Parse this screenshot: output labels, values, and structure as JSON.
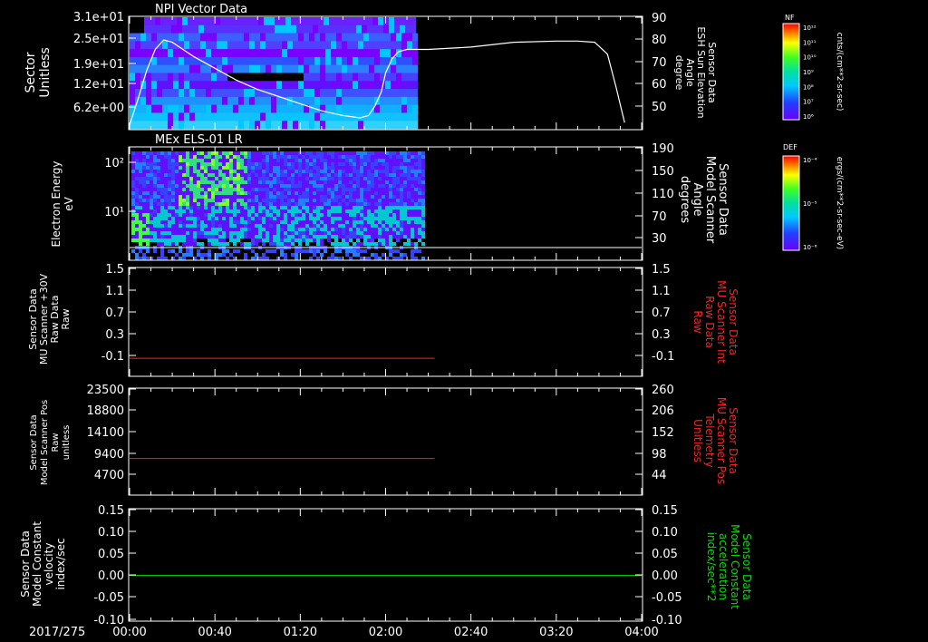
{
  "time_axis": {
    "date_label": "2017/275",
    "ticks": [
      "00:00",
      "00:40",
      "01:20",
      "02:00",
      "02:40",
      "03:20",
      "04:00"
    ],
    "tick_minutes": [
      0,
      40,
      80,
      120,
      160,
      200,
      240
    ],
    "range_minutes": [
      0,
      240
    ]
  },
  "colors": {
    "background": "#000000",
    "axis": "#ffffff",
    "red": "#ff2020",
    "green": "#00e000"
  },
  "panels": [
    {
      "id": "npi",
      "title": "NPI Vector Data",
      "left_label": [
        "Sector",
        "Unitless"
      ],
      "left_ticks": [
        "3.1e+01",
        "2.5e+01",
        "1.9e+01",
        "1.2e+01",
        "6.2e+00"
      ],
      "right_label": [
        "Sensor Data",
        "ESH Sun Elevation",
        "Angle",
        "degree"
      ],
      "right_ticks": [
        "90",
        "80",
        "70",
        "60",
        "50"
      ],
      "colorbar": {
        "title": "NF",
        "unit": "cnts/(cm**2-sr-sec)",
        "ticks": [
          "10¹²",
          "10¹¹",
          "10¹⁰",
          "10⁹",
          "10⁸",
          "10⁷",
          "10⁶"
        ]
      }
    },
    {
      "id": "els",
      "title": "MEx ELS-01 LR",
      "left_label": [
        "Electron Energy",
        "eV"
      ],
      "left_ticks": [
        "10²",
        "10¹"
      ],
      "right_label": [
        "Sensor Data",
        "Model Scanner",
        "Angle",
        "degrees"
      ],
      "right_ticks": [
        "190",
        "150",
        "110",
        "70",
        "30"
      ],
      "colorbar": {
        "title": "DEF",
        "unit": "ergs/(cm**2-sr-sec-eV)",
        "ticks": [
          "10⁻⁴",
          "10⁻⁵",
          "10⁻⁶"
        ]
      }
    },
    {
      "id": "raw30v",
      "left_label": [
        "Sensor Data",
        "MU Scanner +30V",
        "Raw Data",
        "Raw"
      ],
      "left_ticks": [
        "1.5",
        "1.1",
        "0.7",
        "0.3",
        "-0.1"
      ],
      "right_label": [
        "Sensor Data",
        "MU Scanner Int",
        "Raw Data",
        "Raw"
      ],
      "right_ticks": [
        "1.5",
        "1.1",
        "0.7",
        "0.3",
        "-0.1"
      ]
    },
    {
      "id": "pos",
      "left_label": [
        "Sensor Data",
        "Model Scanner Pos",
        "Raw",
        "unitless"
      ],
      "left_ticks": [
        "23500",
        "18800",
        "14100",
        "9400",
        "4700"
      ],
      "right_label": [
        "Sensor Data",
        "MU Scanner Pos",
        "Telemetry",
        "Unitless"
      ],
      "right_ticks": [
        "260",
        "206",
        "152",
        "98",
        "44"
      ]
    },
    {
      "id": "vel",
      "left_label": [
        "Sensor Data",
        "Model Constant",
        "velocity",
        "index/sec"
      ],
      "left_ticks": [
        "0.15",
        "0.10",
        "0.05",
        "0.00",
        "-0.05",
        "-0.10"
      ],
      "right_label": [
        "Sensor Data",
        "Model Constant",
        "acceleration",
        "index/sec**2"
      ],
      "right_ticks": [
        "0.15",
        "0.10",
        "0.05",
        "0.00",
        "-0.05",
        "-0.10"
      ]
    }
  ],
  "chart_data": [
    {
      "type": "heatmap",
      "title": "NPI Vector Data",
      "ylabel": "Sector Unitless",
      "y2label": "Sensor Data ESH Sun Elevation Angle degree",
      "data_coverage_minutes": [
        0,
        133
      ],
      "overlay_series": {
        "name": "ESH Sun Elevation",
        "x_minutes": [
          0,
          4,
          8,
          12,
          16,
          20,
          25,
          30,
          40,
          50,
          60,
          70,
          80,
          90,
          100,
          108,
          112,
          115,
          118,
          120,
          123,
          126,
          130,
          140,
          160,
          180,
          200,
          210,
          218,
          224,
          228,
          232
        ],
        "y_deg": [
          44,
          55,
          67,
          76,
          80,
          79,
          76,
          73,
          68,
          63,
          59,
          56,
          53,
          50,
          48,
          47,
          48,
          52,
          58,
          66,
          72,
          75,
          76,
          76,
          77,
          79,
          79.5,
          79.5,
          79,
          74,
          60,
          45
        ]
      },
      "ylim": [
        2,
        32
      ],
      "y2lim": [
        42,
        90
      ]
    },
    {
      "type": "heatmap",
      "title": "MEx ELS-01 LR",
      "ylabel": "Electron Energy eV",
      "y2label": "Sensor Data Model Scanner Angle degrees",
      "data_coverage_minutes": [
        0,
        137
      ],
      "overlay_series": {
        "name": "Model Scanner Angle",
        "x_minutes": [
          0,
          240
        ],
        "y_deg": [
          10,
          10
        ]
      },
      "y2lim": [
        0,
        190
      ]
    },
    {
      "type": "line",
      "ylabel": "Sensor Data MU Scanner +30V Raw Data Raw",
      "y2label": "Sensor Data MU Scanner Int Raw Data Raw",
      "series": [
        {
          "x_minutes": [
            0,
            143
          ],
          "values": [
            0.0,
            0.0
          ]
        }
      ],
      "ylim": [
        -0.3,
        1.5
      ]
    },
    {
      "type": "line",
      "ylabel": "Sensor Data Model Scanner Pos Raw unitless",
      "y2label": "Sensor Data MU Scanner Pos Telemetry Unitless",
      "series": [
        {
          "x_minutes": [
            0,
            143
          ],
          "values": [
            8100,
            8100
          ]
        }
      ],
      "ylim": [
        0,
        23500
      ]
    },
    {
      "type": "line",
      "ylabel": "Sensor Data Model Constant velocity index/sec",
      "y2label": "Sensor Data Model Constant acceleration index/sec**2",
      "series": [
        {
          "x_minutes": [
            0,
            240
          ],
          "values": [
            0,
            0
          ]
        }
      ],
      "ylim": [
        -0.1,
        0.15
      ]
    }
  ]
}
